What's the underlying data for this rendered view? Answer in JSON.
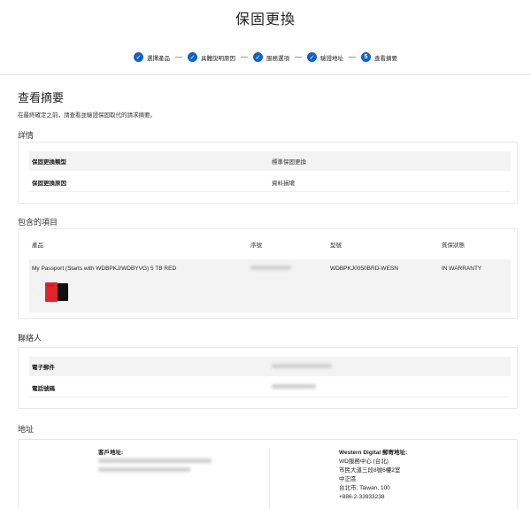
{
  "page": {
    "title": "保固更換"
  },
  "stepper": [
    {
      "label": "選擇產品",
      "state": "done"
    },
    {
      "label": "具體說明原因",
      "state": "done"
    },
    {
      "label": "服務選項",
      "state": "done"
    },
    {
      "label": "驗證地址",
      "state": "done"
    },
    {
      "label": "查看摘要",
      "state": "current",
      "number": "5"
    }
  ],
  "summary": {
    "title": "查看摘要",
    "description": "在最終確定之前，請查看並驗證保固取代的請求摘要。"
  },
  "details": {
    "title": "詳情",
    "rows": [
      {
        "key": "保固更換類型",
        "value": "標準保固更換"
      },
      {
        "key": "保固更換原因",
        "value": "資料損壞"
      }
    ]
  },
  "items": {
    "title": "包含的項目",
    "headers": {
      "product": "產品",
      "serial": "序號",
      "model": "型號",
      "status": "質保狀態"
    },
    "rows": [
      {
        "product": "My Passport (Starts with WDBPKJ/WDBYVG) 5 TB RED",
        "serial": "",
        "model": "WDBPKJ0050BRD-WESN",
        "status": "IN WARRANTY"
      }
    ]
  },
  "contact": {
    "title": "聯絡人",
    "rows": [
      {
        "key": "電子郵件",
        "value": ""
      },
      {
        "key": "電話號碼",
        "value": ""
      }
    ]
  },
  "address": {
    "title": "地址",
    "customer_title": "客戶地址:",
    "wd_title": "Western Digital 郵寄地址:",
    "wd_lines": [
      "WD服務中心 (台北)",
      "市民大道三段8號6樓2室",
      "中正區",
      "台北市, Taiwan, 100",
      "+886-2-33933238"
    ]
  },
  "colors": {
    "accent": "#0f62c7",
    "row_shade": "#f3f3f3",
    "border": "#e8e8e8"
  }
}
